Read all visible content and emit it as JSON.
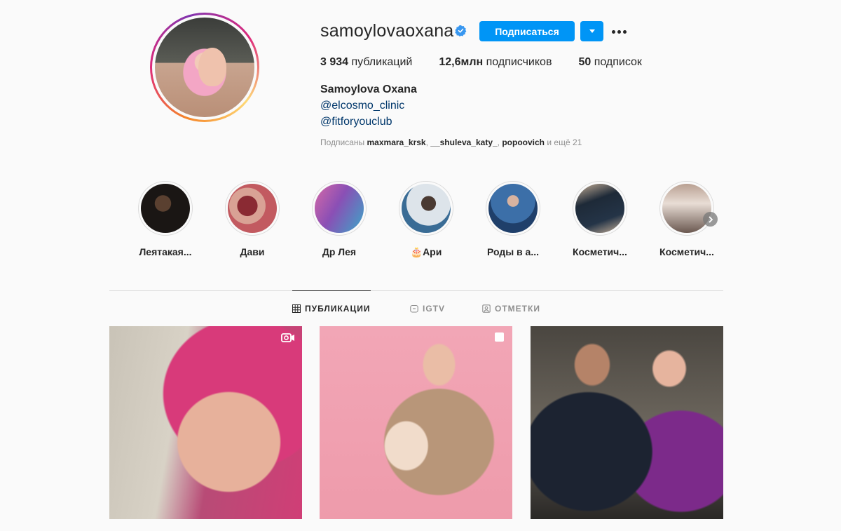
{
  "profile": {
    "username": "samoylovaoxana",
    "follow_label": "Подписаться",
    "stats": {
      "posts_count": "3 934",
      "posts_label": "публикаций",
      "followers_count": "12,6млн",
      "followers_label": "подписчиков",
      "following_count": "50",
      "following_label": "подписок"
    },
    "full_name": "Samoylova Oxana",
    "links": [
      "@elcosmo_clinic",
      "@fitforyouclub"
    ],
    "followed_by": {
      "prefix": "Подписаны",
      "users": [
        "maxmara_krsk",
        "__shuleva_katy_",
        "popoovich"
      ],
      "suffix": "и ещё 21"
    }
  },
  "stories": [
    {
      "label": "Леятакая...",
      "color": "#2a2220"
    },
    {
      "label": "Дави",
      "color": "#b84a55"
    },
    {
      "label": "Др Лея",
      "color": "#a56ab0"
    },
    {
      "label": "🎂Ари",
      "color": "#8aa0b8"
    },
    {
      "label": "Роды в а...",
      "color": "#4f7fae"
    },
    {
      "label": "Косметич...",
      "color": "#2c3a4a"
    },
    {
      "label": "Косметич...",
      "color": "#c7a99a"
    }
  ],
  "tabs": [
    {
      "label": "ПУБЛИКАЦИИ",
      "icon": "grid-icon",
      "active": true
    },
    {
      "label": "IGTV",
      "icon": "igtv-icon",
      "active": false
    },
    {
      "label": "ОТМЕТКИ",
      "icon": "tagged-icon",
      "active": false
    }
  ],
  "colors": {
    "accent": "#0095f6",
    "link": "#00376b",
    "muted": "#8e8e8e"
  }
}
